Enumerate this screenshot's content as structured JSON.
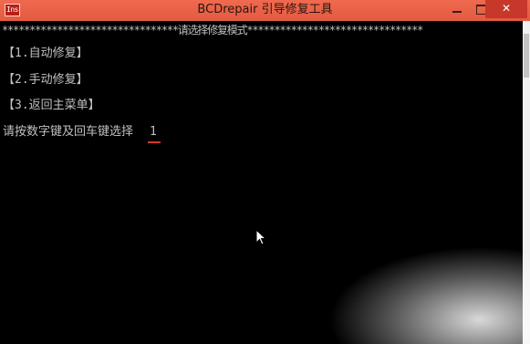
{
  "window": {
    "title": "BCDrepair 引导修复工具",
    "app_icon_text": "Ins"
  },
  "controls": {
    "close_symbol": "✕"
  },
  "console": {
    "banner": "********************************请选择修复模式********************************",
    "options": [
      "【1.自动修复】",
      "【2.手动修复】",
      "【3.返回主菜单】"
    ],
    "prompt": "请按数字键及回车键选择",
    "input_value": "1"
  },
  "colors": {
    "titlebar": "#e35a40",
    "console_bg": "#000000",
    "console_text": "#c0c0c0",
    "caret": "#d23a2a"
  }
}
